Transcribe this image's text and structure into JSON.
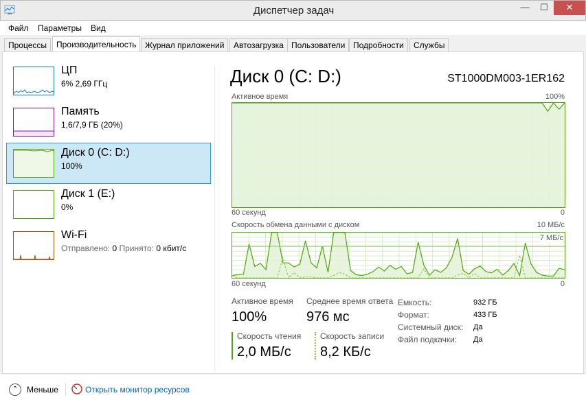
{
  "window": {
    "title": "Диспетчер задач",
    "minimize": "—",
    "maximize": "☐",
    "close": "✕"
  },
  "menu": [
    "Файл",
    "Параметры",
    "Вид"
  ],
  "tabs": [
    "Процессы",
    "Производительность",
    "Журнал приложений",
    "Автозагрузка",
    "Пользователи",
    "Подробности",
    "Службы"
  ],
  "sidebar": [
    {
      "name": "ЦП",
      "value": "6% 2,69 ГГц",
      "color": "#1779ba"
    },
    {
      "name": "Память",
      "value": "1,6/7,9 ГБ (20%)",
      "color": "#8b12ae"
    },
    {
      "name": "Диск 0 (C: D:)",
      "value": "100%",
      "color": "#4da60c"
    },
    {
      "name": "Диск 1 (E:)",
      "value": "0%",
      "color": "#4da60c"
    },
    {
      "name": "Wi-Fi",
      "sent_label": "Отправлено:",
      "sent": "0",
      "recv_label": "Принято:",
      "recv": "0 кбит/с",
      "color": "#a74f01"
    }
  ],
  "main": {
    "title": "Диск 0 (C: D:)",
    "model": "ST1000DM003-1ER162",
    "active_chart": {
      "label": "Активное время",
      "max": "100%",
      "xleft": "60 секунд",
      "xright": "0"
    },
    "transfer_chart": {
      "label": "Скорость обмена данными с диском",
      "max": "10 МБ/с",
      "marker": "7 МБ/с",
      "xleft": "60 секунд",
      "xright": "0"
    },
    "stats": {
      "active_label": "Активное время",
      "active": "100%",
      "resp_label": "Среднее время ответа",
      "resp": "976 мс",
      "read_label": "Скорость чтения",
      "read": "2,0 МБ/с",
      "write_label": "Скорость записи",
      "write": "8,2 КБ/с"
    },
    "props": [
      {
        "k": "Емкость:",
        "v": "932 ГБ"
      },
      {
        "k": "Формат:",
        "v": "433 ГБ"
      },
      {
        "k": "Системный диск:",
        "v": "Да"
      },
      {
        "k": "Файл подкачки:",
        "v": "Да"
      }
    ]
  },
  "footer": {
    "less": "Меньше",
    "monitor": "Открыть монитор ресурсов"
  },
  "chart_data": [
    {
      "type": "line",
      "title": "Активное время",
      "ylim": [
        0,
        100
      ],
      "xlim": [
        60,
        0
      ],
      "series": [
        {
          "name": "active",
          "values": [
            100,
            100,
            100,
            100,
            100,
            100,
            100,
            100,
            100,
            100,
            100,
            100,
            100,
            100,
            100,
            100,
            100,
            100,
            100,
            100,
            100,
            100,
            100,
            100,
            100,
            100,
            100,
            100,
            100,
            100,
            100,
            100,
            100,
            100,
            100,
            100,
            100,
            100,
            100,
            100,
            100,
            100,
            100,
            100,
            100,
            100,
            100,
            100,
            100,
            100,
            100,
            100,
            100,
            100,
            100,
            100,
            92,
            100,
            94,
            100
          ]
        }
      ]
    },
    {
      "type": "area",
      "title": "Скорость обмена данными с диском",
      "ylim": [
        0,
        10
      ],
      "xlim": [
        60,
        0
      ],
      "series": [
        {
          "name": "Скорость чтения",
          "values": [
            0.5,
            0.7,
            0.8,
            7.5,
            2.5,
            3.2,
            1.8,
            10,
            10,
            3.3,
            3.3,
            2.4,
            3.0,
            8.2,
            3.3,
            2.2,
            7.0,
            1.2,
            10,
            10,
            10,
            1.6,
            0.7,
            0.5,
            0.8,
            1.4,
            2.4,
            1.5,
            2.8,
            1.9,
            2.5,
            0.9,
            1.2,
            7.9,
            2.8,
            0.6,
            1.8,
            1.2,
            2.2,
            4.5,
            8.7,
            1.6,
            0.8,
            2.0,
            2.6,
            1.4,
            1.1,
            1.9,
            0.6,
            1.6,
            3.2,
            0.5,
            7.7,
            3.1,
            1.2,
            0.6,
            0.4,
            0.4,
            2.1,
            1.8
          ]
        },
        {
          "name": "Скорость записи",
          "values": [
            0.5,
            0,
            0,
            0,
            0,
            0,
            0,
            0,
            0,
            4.5,
            0,
            1.2,
            0,
            0.2,
            0.2,
            0,
            0,
            0,
            0.5,
            1.2,
            0.8,
            0,
            0,
            0,
            0,
            0,
            0,
            0,
            0,
            0,
            0,
            0,
            0,
            0,
            2.0,
            0,
            0,
            0,
            0,
            0,
            0.6,
            1.0,
            0,
            1.0,
            0,
            0,
            0,
            0,
            0,
            0,
            0,
            5.0,
            0,
            0,
            0,
            0,
            0,
            0,
            0,
            0
          ]
        }
      ]
    }
  ]
}
